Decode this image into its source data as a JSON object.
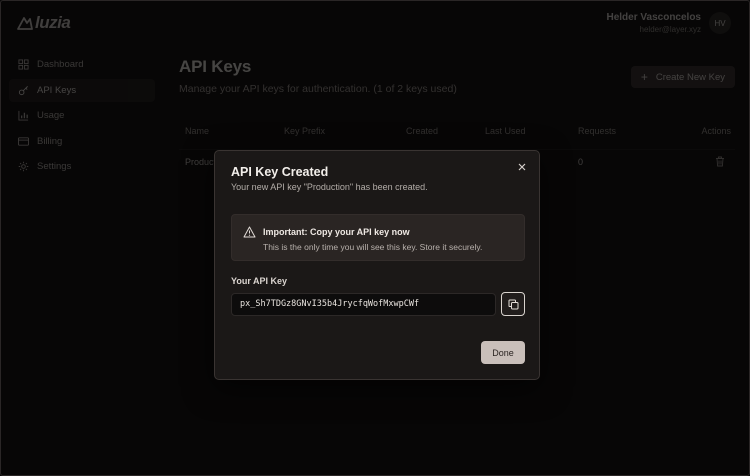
{
  "app": {
    "logo_text": "luzia"
  },
  "user": {
    "name": "Helder Vasconcelos",
    "email": "helder@layer.xyz",
    "initials": "HV"
  },
  "sidebar": {
    "items": [
      {
        "label": "Dashboard",
        "icon": "grid-icon",
        "active": false
      },
      {
        "label": "API Keys",
        "icon": "key-icon",
        "active": true
      },
      {
        "label": "Usage",
        "icon": "bar-chart-icon",
        "active": false
      },
      {
        "label": "Billing",
        "icon": "credit-card-icon",
        "active": false
      },
      {
        "label": "Settings",
        "icon": "gear-icon",
        "active": false
      }
    ]
  },
  "main": {
    "title": "API Keys",
    "subtitle": "Manage your API keys for authentication. (1 of 2 keys used)",
    "create_button": "Create New Key",
    "table": {
      "headers": [
        "Name",
        "Key Prefix",
        "Created",
        "Last Used",
        "Requests",
        "Actions"
      ],
      "rows": [
        {
          "name": "Production",
          "requests": "0"
        }
      ]
    }
  },
  "dialog": {
    "title": "API Key Created",
    "description": "Your new API key \"Production\" has been created.",
    "alert_title": "Important: Copy your API key now",
    "alert_body": "This is the only time you will see this key. Store it securely.",
    "key_label": "Your API Key",
    "key_value": "px_Sh7TDGz8GNvI35b4JrycfqWofMxwpCWf",
    "done_button": "Done"
  },
  "colors": {
    "accent": "#c9bfba",
    "background": "#0b0a0a",
    "dialog": "#1b1817"
  }
}
